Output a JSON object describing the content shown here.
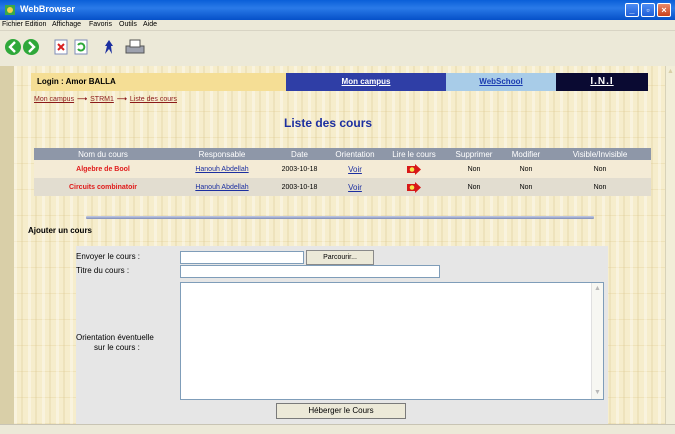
{
  "window": {
    "title": "WebBrowser"
  },
  "menu": [
    "Fichier",
    "Edition",
    "Affichage",
    "Favoris",
    "Outils",
    "Aide"
  ],
  "toolbar": {
    "icons": [
      "back-icon",
      "forward-icon",
      "stop-icon",
      "refresh-icon",
      "home-icon",
      "print-icon"
    ]
  },
  "nav": {
    "login": "Login : Amor BALLA",
    "campus": "Mon campus",
    "webschool": "WebSchool",
    "ini": "I.N.I"
  },
  "breadcrumb": [
    "Mon campus",
    "STRM1",
    "Liste des cours"
  ],
  "page_title": "Liste des cours",
  "courses": {
    "headers": [
      "Nom du cours",
      "Responsable",
      "Date",
      "Orientation",
      "Lire le cours",
      "Supprimer",
      "Modifier",
      "Visible/Invisible"
    ],
    "rows": [
      {
        "name": "Algebre de Bool",
        "responsable": "Hanouh Abdellah",
        "date": "2003-10-18",
        "orientation": "Voir",
        "supprimer": "Non",
        "modifier": "Non",
        "visible": "Non"
      },
      {
        "name": "Circuits combinatoir",
        "responsable": "Hanouh Abdellah",
        "date": "2003-10-18",
        "orientation": "Voir",
        "supprimer": "Non",
        "modifier": "Non",
        "visible": "Non"
      }
    ]
  },
  "add_section": {
    "title": "Ajouter un cours",
    "send_label": "Envoyer le cours :",
    "browse_button": "Parcourir...",
    "course_title_label": "Titre du cours :",
    "orientation_label_1": "Orientation éventuelle",
    "orientation_label_2": "sur le cours :",
    "submit_button": "Héberger le Cours"
  }
}
